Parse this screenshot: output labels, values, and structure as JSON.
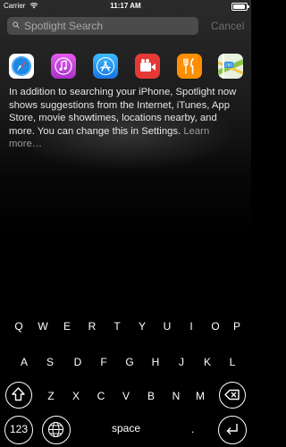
{
  "status_bar": {
    "carrier": "Carrier",
    "time": "11:17 AM"
  },
  "search": {
    "placeholder": "Spotlight Search",
    "cancel_label": "Cancel"
  },
  "suggested_apps": [
    {
      "name": "Safari",
      "icon": "safari-icon",
      "color": "#1e88e5"
    },
    {
      "name": "iTunes Store",
      "icon": "itunes-icon",
      "color": "#d14fd8"
    },
    {
      "name": "App Store",
      "icon": "app-store-icon",
      "color": "#1e9ef0"
    },
    {
      "name": "Videos",
      "icon": "videos-icon",
      "color": "#e53935"
    },
    {
      "name": "Food",
      "icon": "fork-knife-icon",
      "color": "#ff8f00"
    },
    {
      "name": "Maps",
      "icon": "maps-icon",
      "color": "#8bc34a"
    }
  ],
  "info": {
    "text": "In addition to searching your iPhone, Spotlight now shows suggestions from the Internet, iTunes, App Store, movie showtimes, locations nearby, and more. You can change this in Settings.",
    "learn_more": "Learn more…"
  },
  "keyboard": {
    "row1": [
      "Q",
      "W",
      "E",
      "R",
      "T",
      "Y",
      "U",
      "I",
      "O",
      "P"
    ],
    "row2": [
      "A",
      "S",
      "D",
      "F",
      "G",
      "H",
      "J",
      "K",
      "L"
    ],
    "row3": [
      "Z",
      "X",
      "C",
      "V",
      "B",
      "N",
      "M"
    ],
    "numbers_label": "123",
    "space_label": "space",
    "period_label": "."
  }
}
